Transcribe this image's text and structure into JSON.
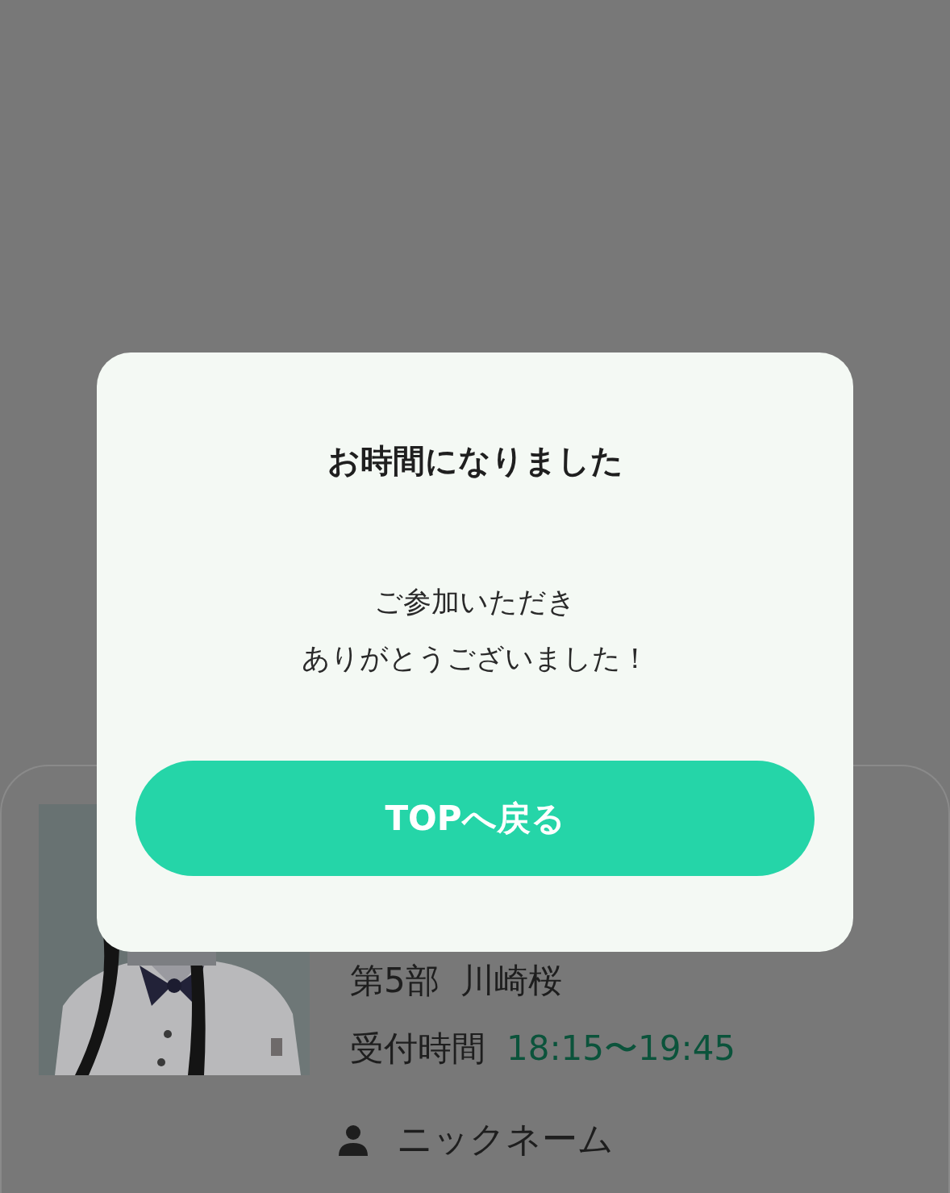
{
  "modal": {
    "title": "お時間になりました",
    "message_lines": [
      "ご参加いただき",
      "ありがとうございました！"
    ],
    "button": "TOPへ戻る"
  },
  "card": {
    "session": "第5部",
    "name": "川崎桜",
    "time_label": "受付時間",
    "time": "18:15〜19:45",
    "nickname_label": "ニックネーム"
  }
}
